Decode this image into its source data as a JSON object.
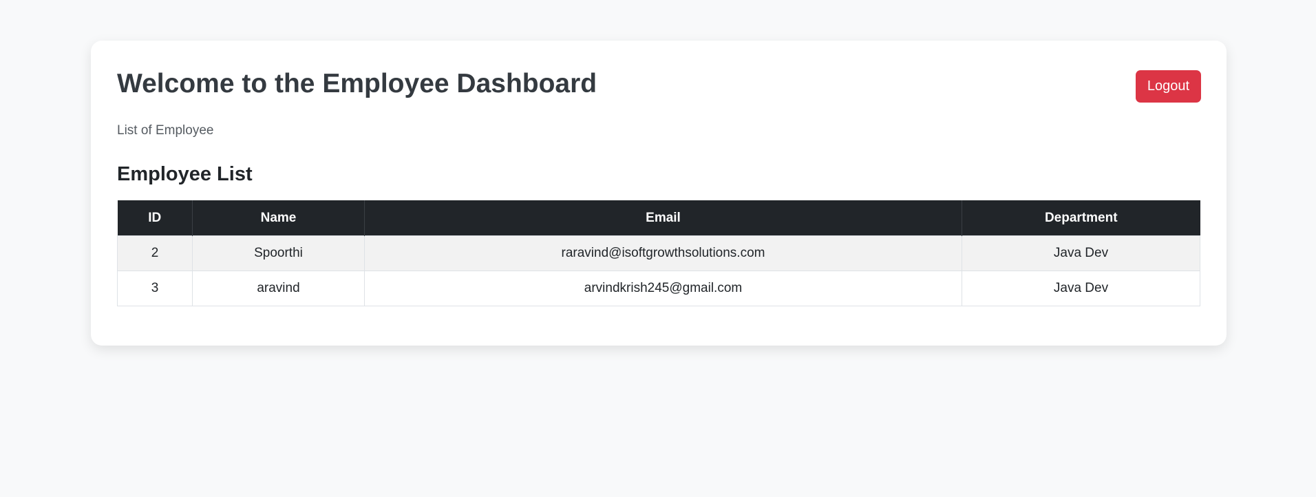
{
  "header": {
    "title": "Welcome to the Employee Dashboard",
    "logout_label": "Logout",
    "subtitle": "List of Employee"
  },
  "section": {
    "title": "Employee List"
  },
  "table": {
    "columns": [
      "ID",
      "Name",
      "Email",
      "Department"
    ],
    "rows": [
      [
        "2",
        "Spoorthi",
        "raravind@isoftgrowthsolutions.com",
        "Java Dev"
      ],
      [
        "3",
        "aravind",
        "arvindkrish245@gmail.com",
        "Java Dev"
      ]
    ]
  },
  "colors": {
    "page_background": "#f8f9fa",
    "logout_button": "#dc3545",
    "table_header": "#212529"
  }
}
